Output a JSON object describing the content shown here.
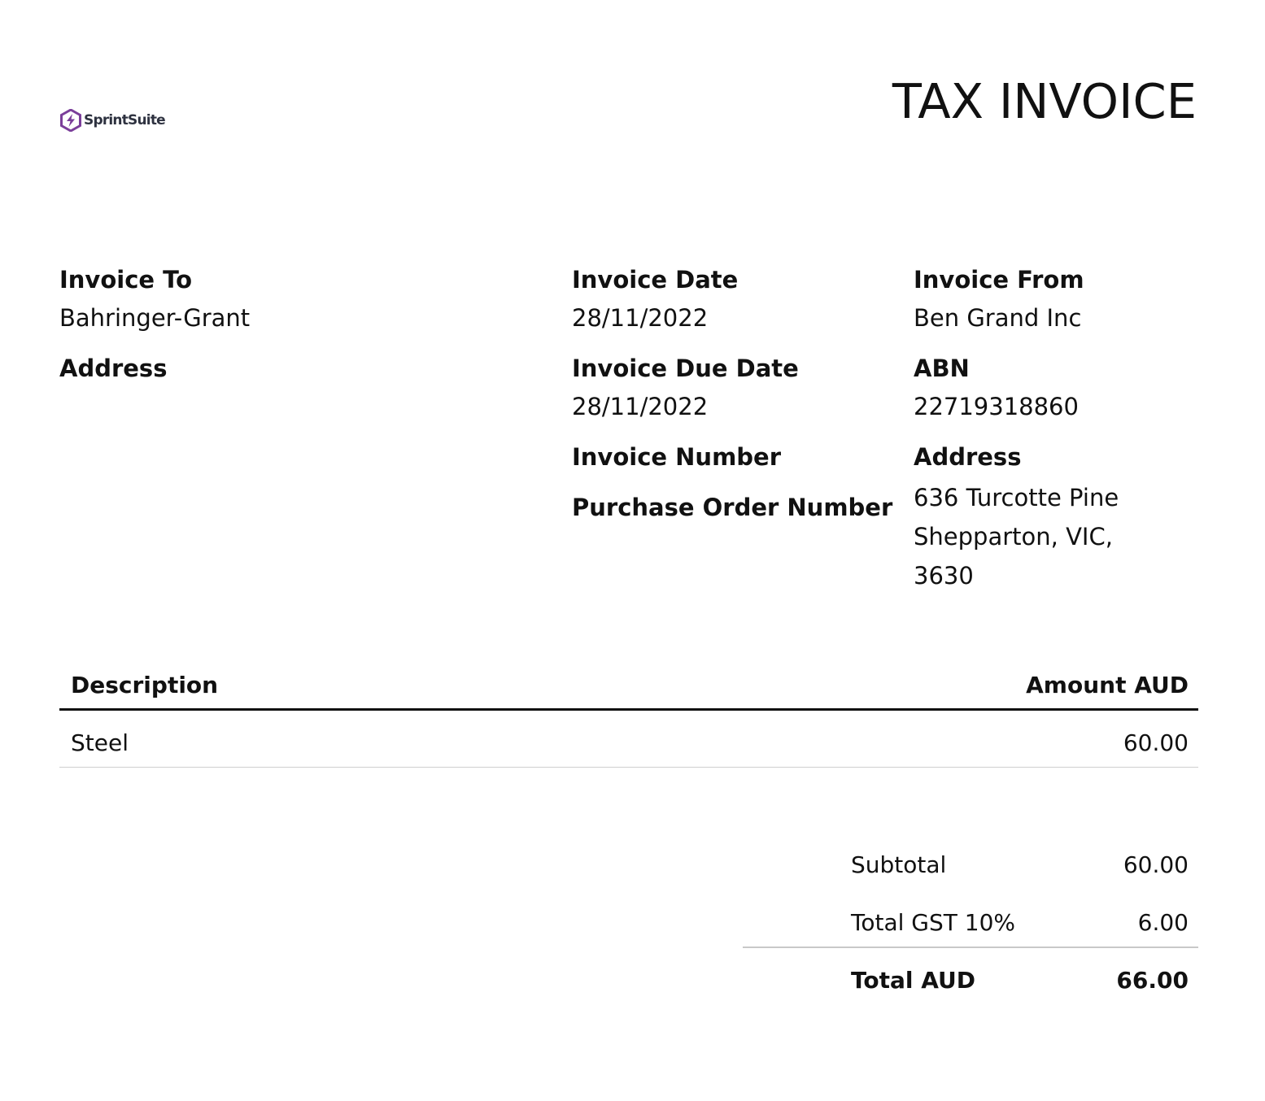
{
  "header": {
    "logo_text": "SprintSuite",
    "title": "TAX INVOICE"
  },
  "colors": {
    "logo_accent": "#7b3f9a",
    "text": "#111111",
    "rule_light": "#cfcfcf"
  },
  "invoice_to": {
    "label": "Invoice To",
    "value": "Bahringer-Grant",
    "address_label": "Address"
  },
  "dates": {
    "invoice_date_label": "Invoice Date",
    "invoice_date": "28/11/2022",
    "due_date_label": "Invoice Due Date",
    "due_date": "28/11/2022",
    "invoice_number_label": "Invoice Number",
    "po_number_label": "Purchase Order Number"
  },
  "invoice_from": {
    "label": "Invoice From",
    "value": "Ben Grand Inc",
    "abn_label": "ABN",
    "abn": "22719318860",
    "address_label": "Address",
    "address_lines": [
      "636 Turcotte Pine",
      "Shepparton, VIC,",
      "3630"
    ]
  },
  "table": {
    "columns": [
      "Description",
      "Amount AUD"
    ],
    "rows": [
      {
        "description": "Steel",
        "amount": "60.00"
      }
    ]
  },
  "totals": {
    "subtotal_label": "Subtotal",
    "subtotal": "60.00",
    "gst_label": "Total GST 10%",
    "gst": "6.00",
    "total_label": "Total AUD",
    "total": "66.00"
  }
}
